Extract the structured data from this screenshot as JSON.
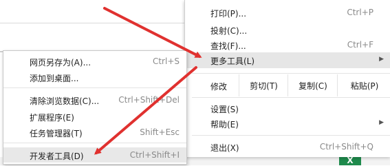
{
  "main_menu": {
    "items": [
      {
        "label": "打印(P)...",
        "shortcut": "Ctrl+P"
      },
      {
        "label": "投射(C)...",
        "shortcut": ""
      },
      {
        "label": "查找(F)...",
        "shortcut": "Ctrl+F"
      },
      {
        "label": "更多工具(L)",
        "shortcut": ""
      }
    ],
    "edit": {
      "label": "修改",
      "cut": "剪切(T)",
      "copy": "复制(C)",
      "paste": "粘贴(P)"
    },
    "settings": "设置(S)",
    "help": "帮助(E)",
    "exit": {
      "label": "退出(X)",
      "shortcut": "Ctrl+Shift+Q"
    }
  },
  "sub_menu": {
    "items": [
      {
        "label": "网页另存为(A)...",
        "shortcut": "Ctrl+S"
      },
      {
        "label": "添加到桌面...",
        "shortcut": ""
      },
      {
        "label": "清除浏览数据(C)...",
        "shortcut": "Ctrl+Shift+Del"
      },
      {
        "label": "扩展程序(E)",
        "shortcut": ""
      },
      {
        "label": "任务管理器(T)",
        "shortcut": "Shift+Esc"
      },
      {
        "label": "开发者工具(D)",
        "shortcut": "Ctrl+Shift+I"
      }
    ]
  },
  "background": {
    "app_icon_text": "X"
  },
  "colors": {
    "annotation_arrow": "#e0312f",
    "excel_green": "#1e8a4c"
  }
}
